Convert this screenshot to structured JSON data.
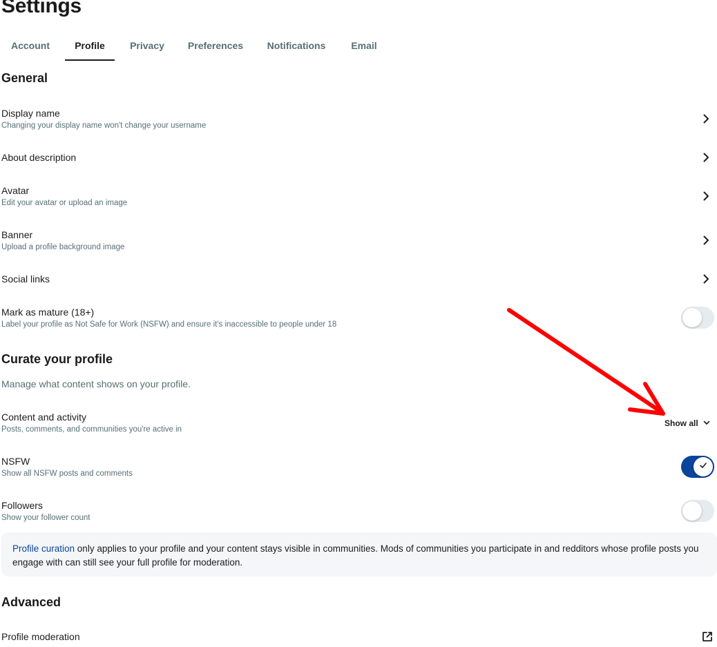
{
  "page_title": "Settings",
  "tabs": [
    {
      "label": "Account",
      "active": false
    },
    {
      "label": "Profile",
      "active": true
    },
    {
      "label": "Privacy",
      "active": false
    },
    {
      "label": "Preferences",
      "active": false
    },
    {
      "label": "Notifications",
      "active": false
    },
    {
      "label": "Email",
      "active": false
    }
  ],
  "general": {
    "title": "General",
    "display_name": {
      "label": "Display name",
      "sub": "Changing your display name won't change your username"
    },
    "about": {
      "label": "About description"
    },
    "avatar": {
      "label": "Avatar",
      "sub": "Edit your avatar or upload an image"
    },
    "banner": {
      "label": "Banner",
      "sub": "Upload a profile background image"
    },
    "social_links": {
      "label": "Social links"
    },
    "mature": {
      "label": "Mark as mature (18+)",
      "sub": "Label your profile as Not Safe for Work (NSFW) and ensure it's inaccessible to people under 18",
      "enabled": false
    }
  },
  "curate": {
    "title": "Curate your profile",
    "description": "Manage what content shows on your profile.",
    "content_activity": {
      "label": "Content and activity",
      "sub": "Posts, comments, and communities you're active in",
      "value": "Show all"
    },
    "nsfw": {
      "label": "NSFW",
      "sub": "Show all NSFW posts and comments",
      "enabled": true
    },
    "followers": {
      "label": "Followers",
      "sub": "Show your follower count",
      "enabled": false
    },
    "notice": {
      "link": "Profile curation",
      "text": " only applies to your profile and your content stays visible in communities. Mods of communities you participate in and redditors whose profile posts you engage with can still see your full profile for moderation."
    }
  },
  "advanced": {
    "title": "Advanced",
    "profile_moderation": {
      "label": "Profile moderation"
    }
  },
  "colors": {
    "accent": "#0a449b",
    "annotation_arrow": "#ff0000",
    "muted_text": "#576f76",
    "toggle_off": "#e5ebee"
  },
  "icons": {
    "row_chevron": "chevron-right-icon",
    "dropdown": "chevron-down-icon",
    "external": "external-link-icon",
    "check": "check-icon"
  }
}
